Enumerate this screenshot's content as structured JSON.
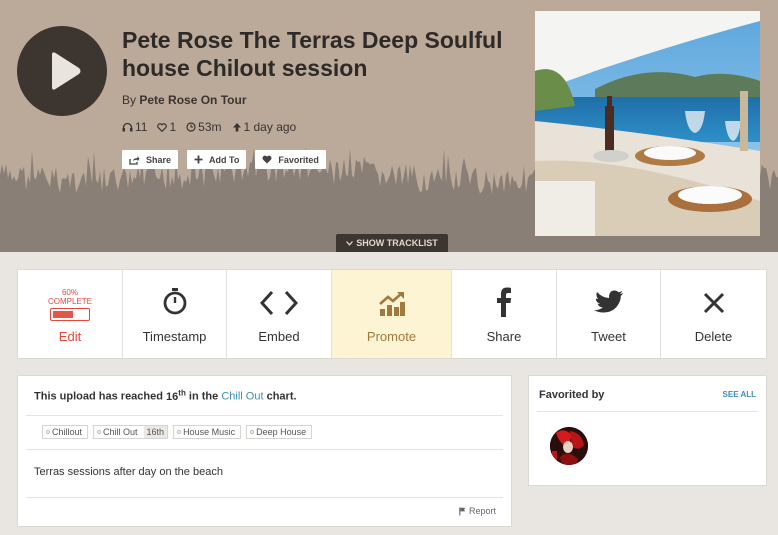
{
  "track": {
    "title": "Pete Rose The Terras Deep Soulful house Chilout session",
    "by_prefix": "By",
    "artist": "Pete Rose On Tour",
    "plays": "11",
    "favorites": "1",
    "duration": "53m",
    "uploaded": "1 day ago"
  },
  "header_buttons": [
    {
      "label": "Share",
      "icon": "share-icon"
    },
    {
      "label": "Add To",
      "icon": "plus-icon"
    },
    {
      "label": "Favorited",
      "icon": "heart-icon"
    }
  ],
  "tracklist_label": "SHOW TRACKLIST",
  "actions": {
    "edit": {
      "label": "Edit",
      "percent_text": "60%",
      "complete_text": "COMPLETE",
      "progress": 0.6
    },
    "timestamp": {
      "label": "Timestamp"
    },
    "embed": {
      "label": "Embed"
    },
    "promote": {
      "label": "Promote"
    },
    "share": {
      "label": "Share"
    },
    "tweet": {
      "label": "Tweet"
    },
    "delete": {
      "label": "Delete"
    }
  },
  "info": {
    "chart_prefix": "This upload has reached",
    "chart_rank": "16",
    "chart_rank_suffix": "th",
    "chart_middle": "in the",
    "chart_link": "Chill Out",
    "chart_suffix": "chart.",
    "tags": [
      "Chillout",
      "Chill Out",
      "House Music",
      "Deep House"
    ],
    "tag_rank": "16th",
    "description": "Terras sessions after day on the beach",
    "report": "Report"
  },
  "favorited": {
    "title": "Favorited by",
    "see_all": "SEE ALL"
  },
  "colors": {
    "header_bg": "#bba99a",
    "wave": "#8a7f76",
    "dark": "#3d3530",
    "accent_blue": "#3e8fb5",
    "edit_red": "#e2493c",
    "promote_bg": "#fdf4d4"
  }
}
